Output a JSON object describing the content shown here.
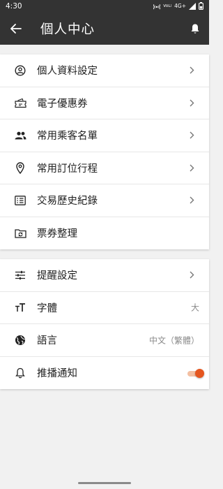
{
  "status_bar": {
    "time": "4:30",
    "network": "4G+",
    "volte": "VoLTE"
  },
  "header": {
    "title": "個人中心"
  },
  "section_account": {
    "items": [
      {
        "label": "個人資料設定"
      },
      {
        "label": "電子優惠券"
      },
      {
        "label": "常用乘客名單"
      },
      {
        "label": "常用訂位行程"
      },
      {
        "label": "交易歷史紀錄"
      },
      {
        "label": "票券整理"
      }
    ]
  },
  "section_settings": {
    "items": [
      {
        "label": "提醒設定"
      },
      {
        "label": "字體",
        "value": "大"
      },
      {
        "label": "語言",
        "value": "中文（繁體）"
      },
      {
        "label": "推播通知",
        "toggle_on": true
      }
    ]
  },
  "colors": {
    "app_bar": "#333333",
    "accent": "#e5561f",
    "background": "#f1f1f1"
  }
}
